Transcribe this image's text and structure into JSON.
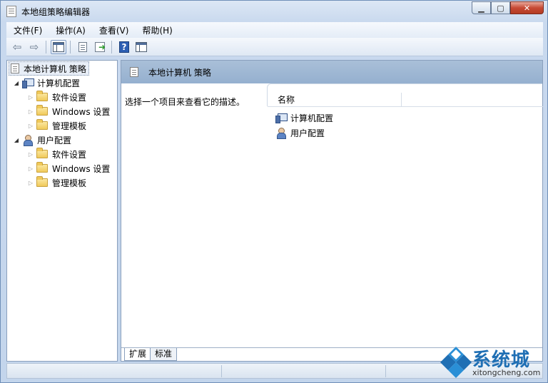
{
  "window": {
    "title": "本地组策略编辑器",
    "minimize_icon": "minimize-icon",
    "maximize_icon": "maximize-icon",
    "close_icon": "close-icon"
  },
  "menubar": {
    "items": [
      {
        "label": "文件(F)"
      },
      {
        "label": "操作(A)"
      },
      {
        "label": "查看(V)"
      },
      {
        "label": "帮助(H)"
      }
    ]
  },
  "toolbar": {
    "buttons": [
      "back-arrow-icon",
      "forward-arrow-icon",
      "show-hide-tree-icon",
      "properties-icon",
      "export-list-icon",
      "help-icon",
      "show-hide-action-pane-icon"
    ]
  },
  "tree": {
    "root": "本地计算机 策略",
    "nodes": [
      {
        "label": "计算机配置",
        "children": [
          "软件设置",
          "Windows 设置",
          "管理模板"
        ]
      },
      {
        "label": "用户配置",
        "children": [
          "软件设置",
          "Windows 设置",
          "管理模板"
        ]
      }
    ]
  },
  "right_pane": {
    "header": "本地计算机 策略",
    "description": "选择一个项目来查看它的描述。",
    "column_name": "名称",
    "items": [
      "计算机配置",
      "用户配置"
    ]
  },
  "tabs": [
    "扩展",
    "标准"
  ],
  "watermark": {
    "brand": "系统城",
    "url": "xitongcheng.com"
  },
  "colors": {
    "header_blue": "#95b0cf",
    "frame_blue": "#c3d5ec",
    "watermark_blue": "#1f6fb4"
  }
}
